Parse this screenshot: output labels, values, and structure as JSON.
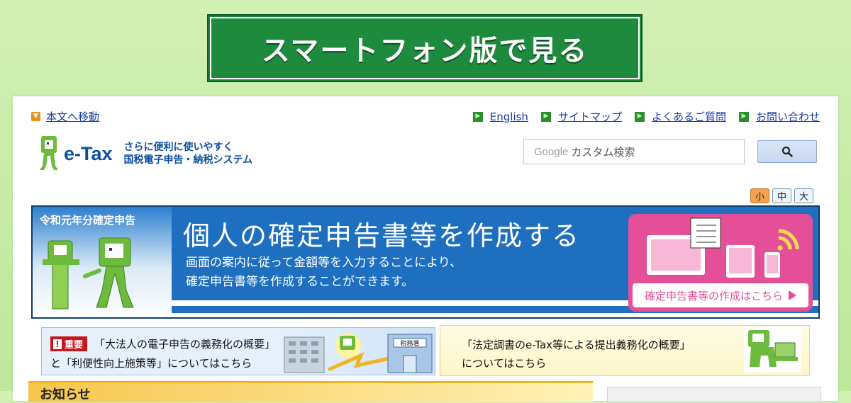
{
  "smartphone_button": {
    "label": "スマートフォン版で見る"
  },
  "header": {
    "skip_link": "本文へ移動",
    "links": [
      "English",
      "サイトマップ",
      "よくあるご質問",
      "お問い合わせ"
    ],
    "logo": {
      "wordmark": "e-Tax",
      "tagline_1": "さらに便利に使いやすく",
      "tagline_2": "国税電子申告・納税システム"
    },
    "search": {
      "google_label": "Google",
      "placeholder": "カスタム検索"
    },
    "font_sizes": [
      "小",
      "中",
      "大"
    ],
    "active_font_size": "小"
  },
  "banner": {
    "label": "令和元年分確定申告",
    "title": "個人の確定申告書等を作成する",
    "desc_1": "画面の案内に従って金額等を入力することにより、",
    "desc_2": "確定申告書等を作成することができます。",
    "cta": "確定申告書等の作成はこちら"
  },
  "notices": {
    "left": {
      "badge": "重要",
      "line_1": "「大法人の電子申告の義務化の概要」",
      "line_2": "と「利便性向上施策等」についてはこちら",
      "building_sign": "税務署"
    },
    "right": {
      "line_1": "「法定調書のe-Tax等による提出義務化の概要」",
      "line_2": "についてはこちら"
    }
  },
  "news_tab": {
    "label": "お知らせ"
  },
  "colors": {
    "green": "#1e8a3e",
    "blue": "#1e6fbf",
    "pink": "#e54f97",
    "link": "#1a3aa8"
  }
}
